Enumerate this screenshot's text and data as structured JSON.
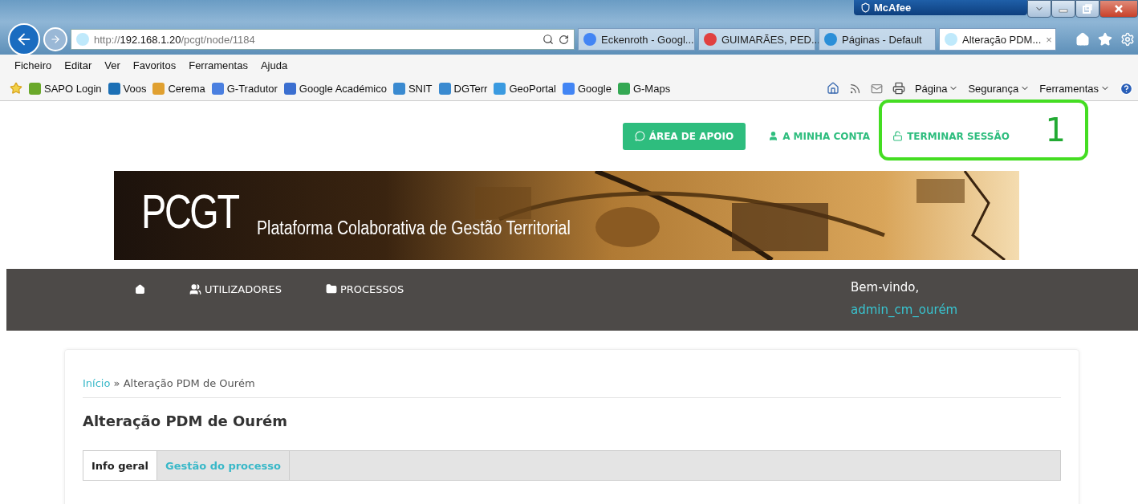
{
  "browser": {
    "security_badge": "McAfee",
    "address": {
      "scheme": "http://",
      "host": "192.168.1.20",
      "path": "/pcgt/node/1184"
    },
    "tabs": [
      {
        "label": "Eckenroth - Googl...",
        "selected": false,
        "color": "#4285f4"
      },
      {
        "label": "GUIMARÃES, PED...",
        "selected": false,
        "color": "#e04040"
      },
      {
        "label": "Páginas - Default",
        "selected": false,
        "color": "#2a8fd8"
      },
      {
        "label": "Alteração PDM...",
        "selected": true,
        "color": "#bfe9fb"
      }
    ],
    "close_tab": "×",
    "menu": [
      "Ficheiro",
      "Editar",
      "Ver",
      "Favoritos",
      "Ferramentas",
      "Ajuda"
    ],
    "favorites": [
      {
        "label": "SAPO Login",
        "color": "#6aa82a"
      },
      {
        "label": "Voos",
        "color": "#1b6fb5"
      },
      {
        "label": "Cerema",
        "color": "#e0a030"
      },
      {
        "label": "G-Tradutor",
        "color": "#4a7fe0"
      },
      {
        "label": "Google Académico",
        "color": "#3b6fd0"
      },
      {
        "label": "SNIT",
        "color": "#3a8ad0"
      },
      {
        "label": "DGTerr",
        "color": "#3a8ad0"
      },
      {
        "label": "GeoPortal",
        "color": "#3a9ae0"
      },
      {
        "label": "Google",
        "color": "#4285f4"
      },
      {
        "label": "G-Maps",
        "color": "#34a853"
      }
    ],
    "commands": [
      "Página",
      "Segurança",
      "Ferramentas"
    ]
  },
  "top_links": [
    {
      "kind": "button",
      "label": "ÁREA DE APOIO"
    },
    {
      "kind": "link",
      "label": "A MINHA CONTA"
    },
    {
      "kind": "link",
      "label": "TERMINAR SESSÃO"
    }
  ],
  "annotation": {
    "label": "1"
  },
  "banner": {
    "title": "PCGT",
    "subtitle": "Plataforma Colaborativa de Gestão Territorial"
  },
  "nav": {
    "items": [
      {
        "kind": "home"
      },
      {
        "kind": "link",
        "label": "UTILIZADORES"
      },
      {
        "kind": "link",
        "label": "PROCESSOS"
      }
    ],
    "welcome": "Bem-vindo,",
    "user": "admin_cm_ourém"
  },
  "breadcrumb": {
    "link": "Início",
    "separator": "»",
    "current": "Alteração PDM de Ourém"
  },
  "page_title": "Alteração PDM de Ourém",
  "content_tabs": [
    {
      "label": "Info geral",
      "selected": true
    },
    {
      "label": "Gestão do processo",
      "selected": false
    }
  ]
}
